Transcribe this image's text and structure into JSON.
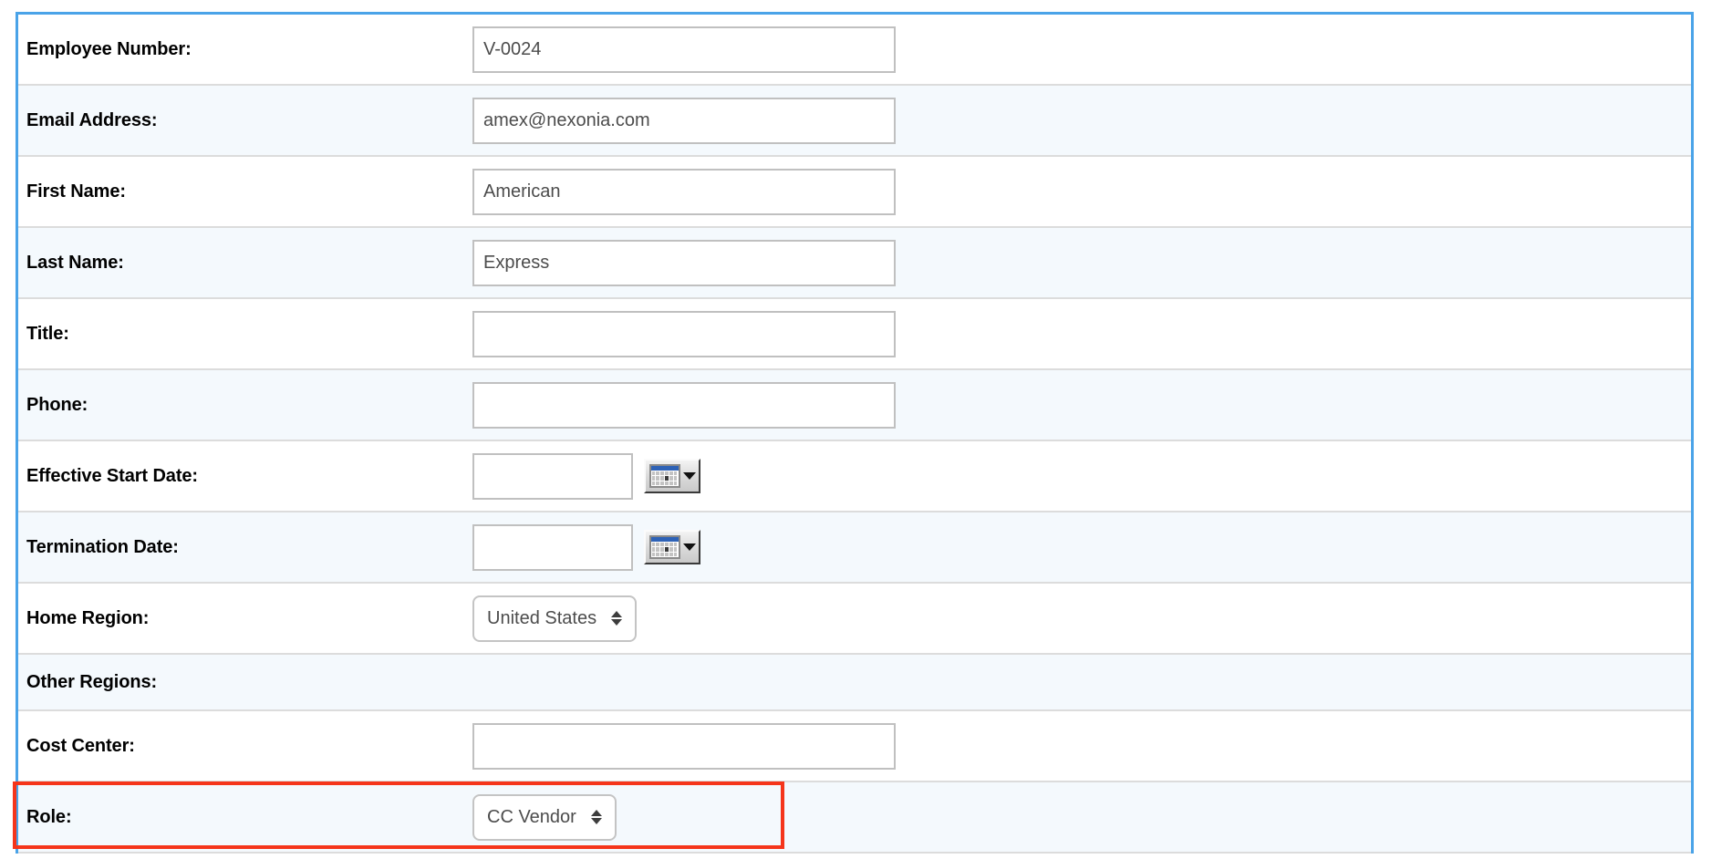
{
  "form": {
    "rows": [
      {
        "label": "Employee Number:",
        "control": "text",
        "value": "V-0024",
        "placeholder": ""
      },
      {
        "label": "Email Address:",
        "control": "text",
        "value": "amex@nexonia.com",
        "placeholder": ""
      },
      {
        "label": "First Name:",
        "control": "text",
        "value": "American",
        "placeholder": ""
      },
      {
        "label": "Last Name:",
        "control": "text",
        "value": "Express",
        "placeholder": ""
      },
      {
        "label": "Title:",
        "control": "text",
        "value": "",
        "placeholder": ""
      },
      {
        "label": "Phone:",
        "control": "text",
        "value": "",
        "placeholder": ""
      },
      {
        "label": "Effective Start Date:",
        "control": "date",
        "value": "",
        "placeholder": ""
      },
      {
        "label": "Termination Date:",
        "control": "date",
        "value": "",
        "placeholder": ""
      },
      {
        "label": "Home Region:",
        "control": "select",
        "value": "United States",
        "placeholder": ""
      },
      {
        "label": "Other Regions:",
        "control": "none",
        "value": "",
        "placeholder": ""
      },
      {
        "label": "Cost Center:",
        "control": "text",
        "value": "",
        "placeholder": ""
      },
      {
        "label": "Role:",
        "control": "select",
        "value": "CC Vendor",
        "placeholder": ""
      }
    ]
  },
  "icons": {
    "calendar": "calendar-icon",
    "dropdown_arrow": "chevron-down-icon",
    "spinner": "select-spinner-icon"
  },
  "colors": {
    "table_border": "#4aa3e8",
    "row_alt_background": "#f4f9fd",
    "row_divider": "#dcdcdc",
    "input_border": "#c0c0c0",
    "label_text": "#010101",
    "value_text": "#4c4c4c",
    "highlight": "#f5351b",
    "calendar_header": "#2e62b6"
  }
}
